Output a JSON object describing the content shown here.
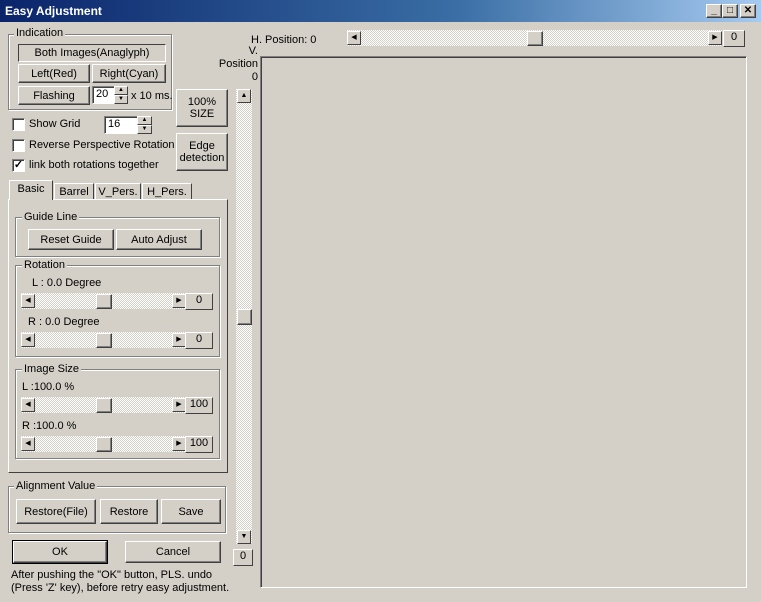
{
  "window": {
    "title": "Easy Adjustment",
    "controls": [
      "_",
      "□",
      "✕"
    ]
  },
  "indication": {
    "label": "Indication",
    "both_images": "Both Images(Anaglyph)",
    "left_red": "Left(Red)",
    "right_cyan": "Right(Cyan)",
    "flashing": "Flashing",
    "flash_interval": "20",
    "flash_unit": "x 10 ms."
  },
  "size_100": "100%\nSIZE",
  "edge_detection": "Edge\ndetection",
  "show_grid": {
    "label": "Show Grid",
    "checked": false,
    "value": "16"
  },
  "reverse_perspective": {
    "label": "Reverse Perspective Rotation",
    "checked": false
  },
  "link_rotations": {
    "label": "link both rotations together",
    "checked": true,
    "mark": "✓"
  },
  "tabs": [
    "Basic",
    "Barrel",
    "V_Pers.",
    "H_Pers."
  ],
  "guide_line": {
    "label": "Guide Line",
    "reset": "Reset Guide",
    "auto": "Auto Adjust"
  },
  "rotation": {
    "label": "Rotation",
    "left_label": "L : 0.0 Degree",
    "left_value": "0",
    "left_level": 0.5,
    "right_label": "R : 0.0 Degree",
    "right_value": "0",
    "right_level": 0.5
  },
  "image_size": {
    "label": "Image Size",
    "left_label": "L :100.0 %",
    "left_value": "100",
    "left_level": 0.5,
    "right_label": "R :100.0 %",
    "right_value": "100",
    "right_level": 0.5
  },
  "alignment": {
    "label": "Alignment Value",
    "restore_file": "Restore(File)",
    "restore": "Restore",
    "save": "Save"
  },
  "ok": "OK",
  "cancel": "Cancel",
  "note": "After pushing the \"OK\" button, PLS. undo\n(Press 'Z' key), before retry easy adjustment.",
  "h_position": {
    "label": "H. Position:  0",
    "value": "0",
    "level": 0.5
  },
  "v_position": {
    "label": "V.\nPosition\n0",
    "value": "0",
    "level": 0.5
  },
  "arrows": {
    "left": "◀",
    "right": "▶",
    "up": "▲",
    "down": "▼"
  }
}
